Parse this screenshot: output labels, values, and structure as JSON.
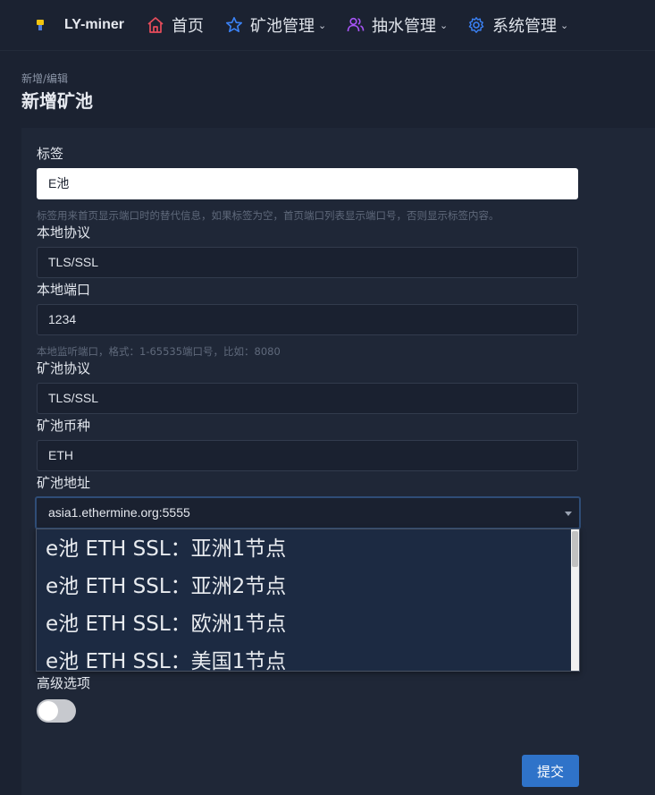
{
  "nav": {
    "brand": "LY-miner",
    "home": "首页",
    "pools": "矿池管理",
    "pump": "抽水管理",
    "system": "系统管理"
  },
  "page": {
    "breadcrumb": "新增/编辑",
    "title": "新增矿池"
  },
  "form": {
    "tag_label": "标签",
    "tag_value": "E池",
    "tag_hint": "标签用来首页显示端口时的替代信息，如果标签为空，首页端口列表显示端口号，否则显示标签内容。",
    "local_protocol_label": "本地协议",
    "local_protocol_value": "TLS/SSL",
    "local_port_label": "本地端口",
    "local_port_value": "1234",
    "local_port_hint": "本地监听端口，格式：1-65535端口号，比如：8080",
    "pool_protocol_label": "矿池协议",
    "pool_protocol_value": "TLS/SSL",
    "pool_coin_label": "矿池币种",
    "pool_coin_value": "ETH",
    "pool_address_label": "矿池地址",
    "pool_address_value": "asia1.ethermine.org:5555",
    "pool_address_options": [
      "e池 ETH SSL：亚洲1节点",
      "e池 ETH SSL：亚洲2节点",
      "e池 ETH SSL：欧洲1节点",
      "e池 ETH SSL：美国1节点"
    ],
    "advanced_label": "高级选项",
    "advanced_enabled": false,
    "submit_label": "提交"
  },
  "colors": {
    "background": "#1b2231",
    "card": "#1f2737",
    "accent": "#2f73c9",
    "home_icon": "#e74c5b",
    "pools_icon": "#3b82f6",
    "pump_icon": "#a855f7",
    "system_icon": "#3b82f6"
  },
  "icons": {
    "home": "home-icon",
    "pools": "star-icon",
    "pump": "users-icon",
    "system": "gear-icon"
  }
}
